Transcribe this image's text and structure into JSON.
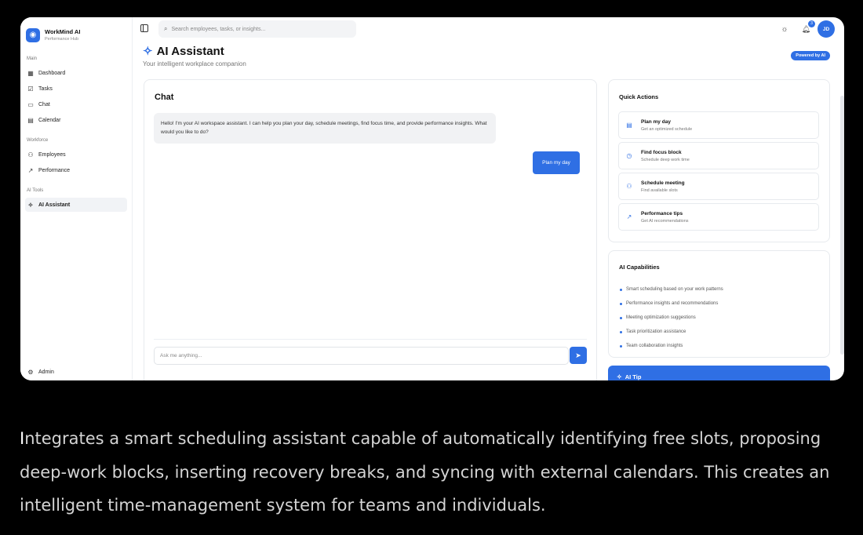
{
  "brand": {
    "name": "WorkMind AI",
    "subtitle": "Performance Hub",
    "logo_icon": "brain-icon"
  },
  "sidebar": {
    "sections": [
      {
        "label": "Main",
        "items": [
          {
            "label": "Dashboard",
            "icon": "grid-icon"
          },
          {
            "label": "Tasks",
            "icon": "checkbox-icon"
          },
          {
            "label": "Chat",
            "icon": "message-icon"
          },
          {
            "label": "Calendar",
            "icon": "calendar-icon"
          }
        ]
      },
      {
        "label": "Workforce",
        "items": [
          {
            "label": "Employees",
            "icon": "users-icon"
          },
          {
            "label": "Performance",
            "icon": "trend-icon"
          }
        ]
      },
      {
        "label": "AI Tools",
        "items": [
          {
            "label": "AI Assistant",
            "icon": "sparkle-icon",
            "active": true
          }
        ]
      }
    ],
    "admin_label": "Admin"
  },
  "topbar": {
    "search_placeholder": "Search employees, tasks, or insights...",
    "notification_count": "3",
    "avatar_initials": "JD"
  },
  "page": {
    "title": "AI Assistant",
    "subtitle": "Your intelligent workplace companion",
    "badge": "Powered by AI"
  },
  "chat": {
    "title": "Chat",
    "bot_message": "Hello! I'm your AI workspace assistant. I can help you plan your day, schedule meetings, find focus time, and provide performance insights. What would you like to do?",
    "user_message": "Plan my day",
    "input_placeholder": "Ask me anything..."
  },
  "quick_actions": {
    "title": "Quick Actions",
    "items": [
      {
        "label": "Plan my day",
        "desc": "Get an optimized schedule",
        "icon": "calendar-icon"
      },
      {
        "label": "Find focus block",
        "desc": "Schedule deep work time",
        "icon": "clock-icon"
      },
      {
        "label": "Schedule meeting",
        "desc": "Find available slots",
        "icon": "users-icon"
      },
      {
        "label": "Performance tips",
        "desc": "Get AI recommendations",
        "icon": "trend-icon"
      }
    ]
  },
  "capabilities": {
    "title": "AI Capabilities",
    "items": [
      "Smart scheduling based on your work patterns",
      "Performance insights and recommendations",
      "Meeting optimization suggestions",
      "Task prioritization assistance",
      "Team collaboration insights"
    ]
  },
  "tip": {
    "title": "AI Tip"
  },
  "caption": {
    "first_letter": "I",
    "text": "ntegrates a smart scheduling assistant capable of automatically identifying free slots, proposing deep-work blocks, inserting recovery breaks, and syncing with external calendars. This creates an intelligent time-management system for teams and individuals."
  },
  "colors": {
    "accent": "#2f6fe4",
    "background": "#000000"
  }
}
